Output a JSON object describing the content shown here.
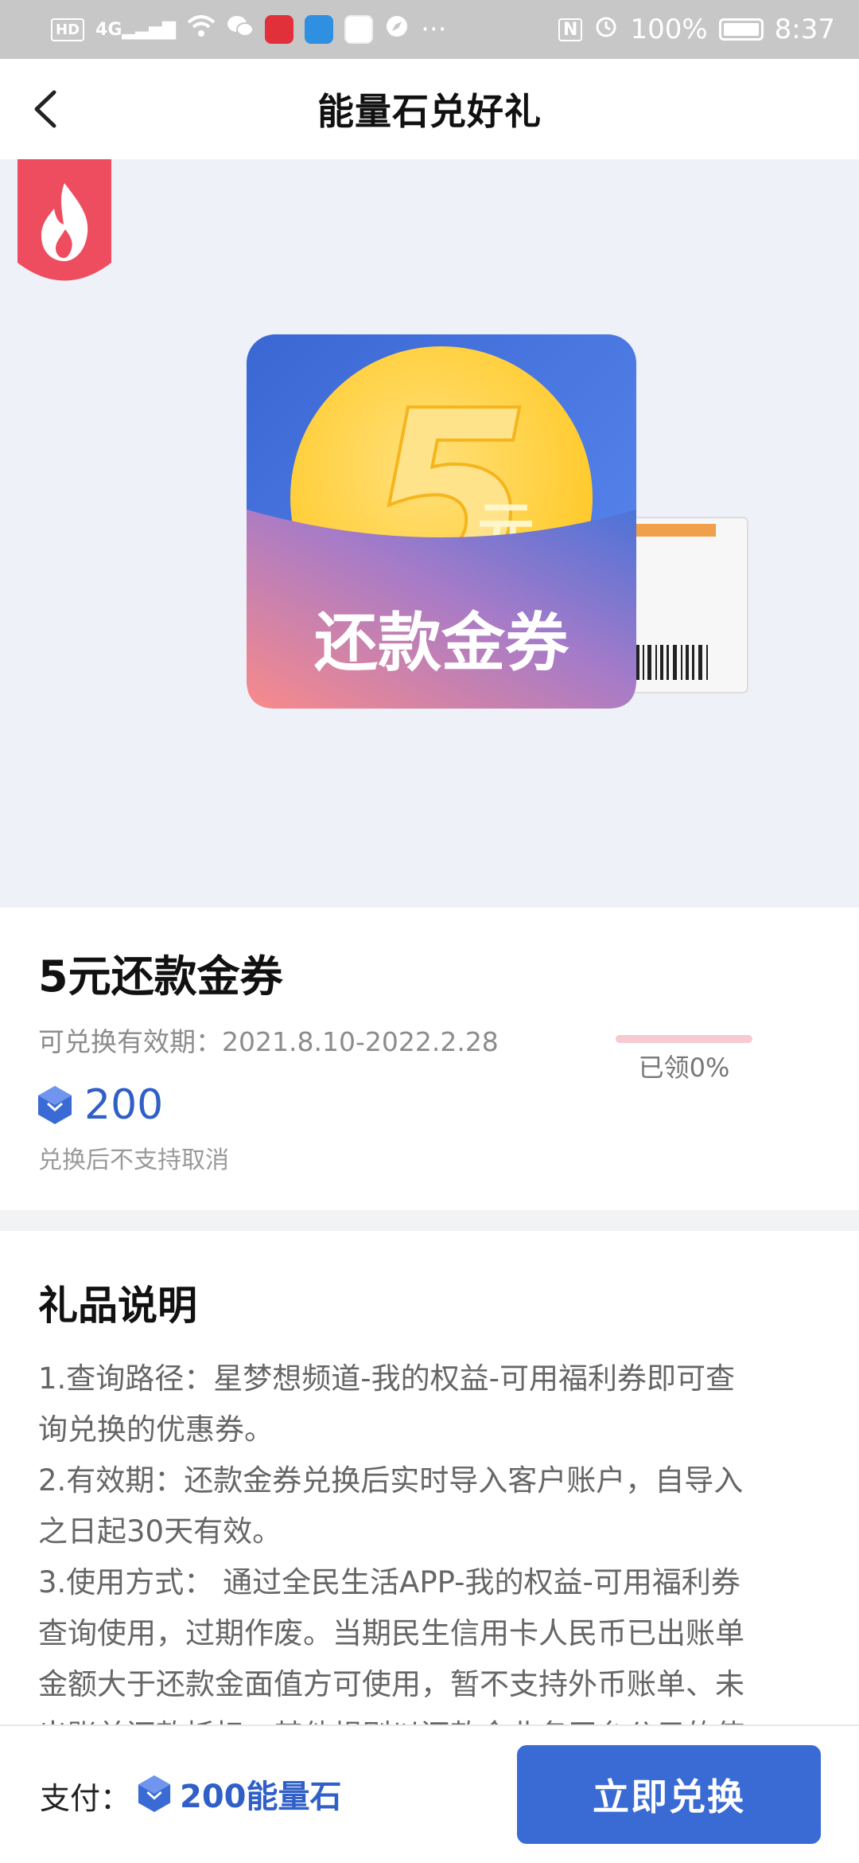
{
  "status_bar": {
    "network_tag": "HD",
    "signal": "4G",
    "battery_percent": "100%",
    "time": "8:37",
    "more": "···"
  },
  "header": {
    "title": "能量石兑好礼",
    "back_icon": "chevron-left-icon"
  },
  "hero": {
    "badge_icon": "flame-icon",
    "voucher_amount": "5",
    "voucher_unit": "元",
    "voucher_caption": "还款金券"
  },
  "product": {
    "title": "5元还款金券",
    "validity": "可兑换有效期：2021.8.10-2022.2.28",
    "price": "200",
    "price_icon": "energy-stone-icon",
    "no_cancel_note": "兑换后不支持取消",
    "claimed_label": "已领0%",
    "claimed_fraction": 0.0
  },
  "description": {
    "heading": "礼品说明",
    "lines": [
      "1.查询路径：星梦想频道-我的权益-可用福利券即可查",
      "询兑换的优惠券。",
      "2.有效期：还款金券兑换后实时导入客户账户，自导入",
      "之日起30天有效。",
      "3.使用方式： 通过全民生活APP-我的权益-可用福利券",
      "查询使用，过期作废。当期民生信用卡人民币已出账单",
      "金额大于还款金面值方可使用，暂不支持外币账单、未",
      "出账单还款抵扣，其他规则以还款金业务平台公示的使"
    ]
  },
  "bottom_bar": {
    "pay_label": "支付：",
    "pay_amount": "200能量石",
    "redeem_label": "立即兑换"
  },
  "colors": {
    "accent": "#3a6bd4",
    "price_blue": "#2f5fc7",
    "badge_red": "#ee4d5f",
    "progress_pink": "#f7c9d1"
  }
}
